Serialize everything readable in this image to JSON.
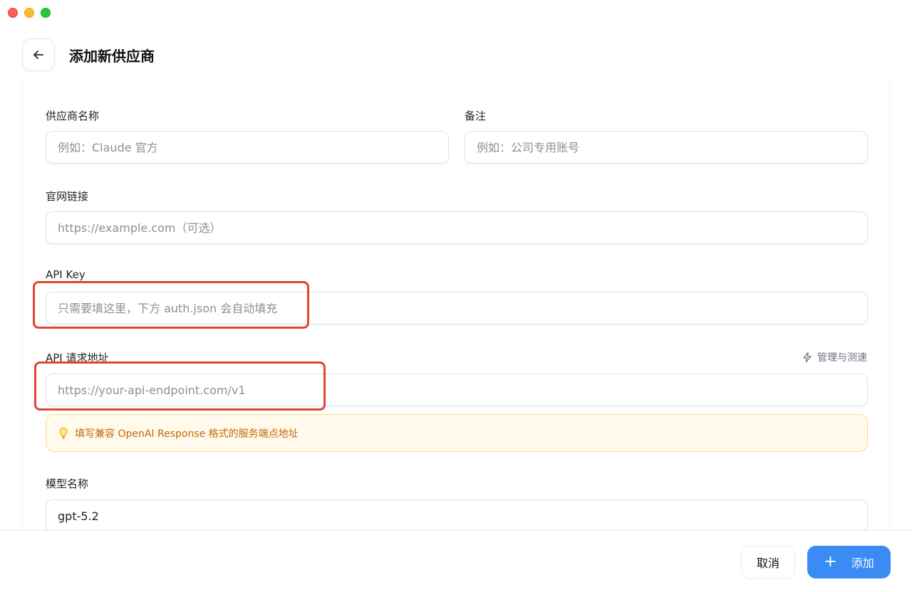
{
  "window": {
    "controls": [
      "close",
      "minimize",
      "zoom"
    ]
  },
  "header": {
    "title": "添加新供应商",
    "back_icon": "arrow-left-icon"
  },
  "form": {
    "provider_name": {
      "label": "供应商名称",
      "value": "",
      "placeholder": "例如：Claude 官方"
    },
    "notes": {
      "label": "备注",
      "value": "",
      "placeholder": "例如：公司专用账号"
    },
    "website": {
      "label": "官网链接",
      "value": "",
      "placeholder": "https://example.com（可选）"
    },
    "api_key": {
      "label": "API Key",
      "value": "",
      "placeholder": "只需要填这里，下方 auth.json 会自动填充"
    },
    "api_endpoint": {
      "label": "API 请求地址",
      "value": "",
      "placeholder": "https://your-api-endpoint.com/v1",
      "manage_link": "管理与测速",
      "manage_icon": "lightning-icon",
      "hint": "填写兼容 OpenAI Response 格式的服务端点地址",
      "hint_icon": "lightbulb-icon"
    },
    "model_name": {
      "label": "模型名称",
      "value": "gpt-5.2",
      "placeholder": ""
    }
  },
  "footer": {
    "cancel_label": "取消",
    "add_label": "添加",
    "add_icon": "plus-icon"
  },
  "colors": {
    "primary": "#3b8bf5",
    "highlight": "#e0452e",
    "hint_bg": "#fffaeb",
    "hint_text": "#c26a0a"
  }
}
